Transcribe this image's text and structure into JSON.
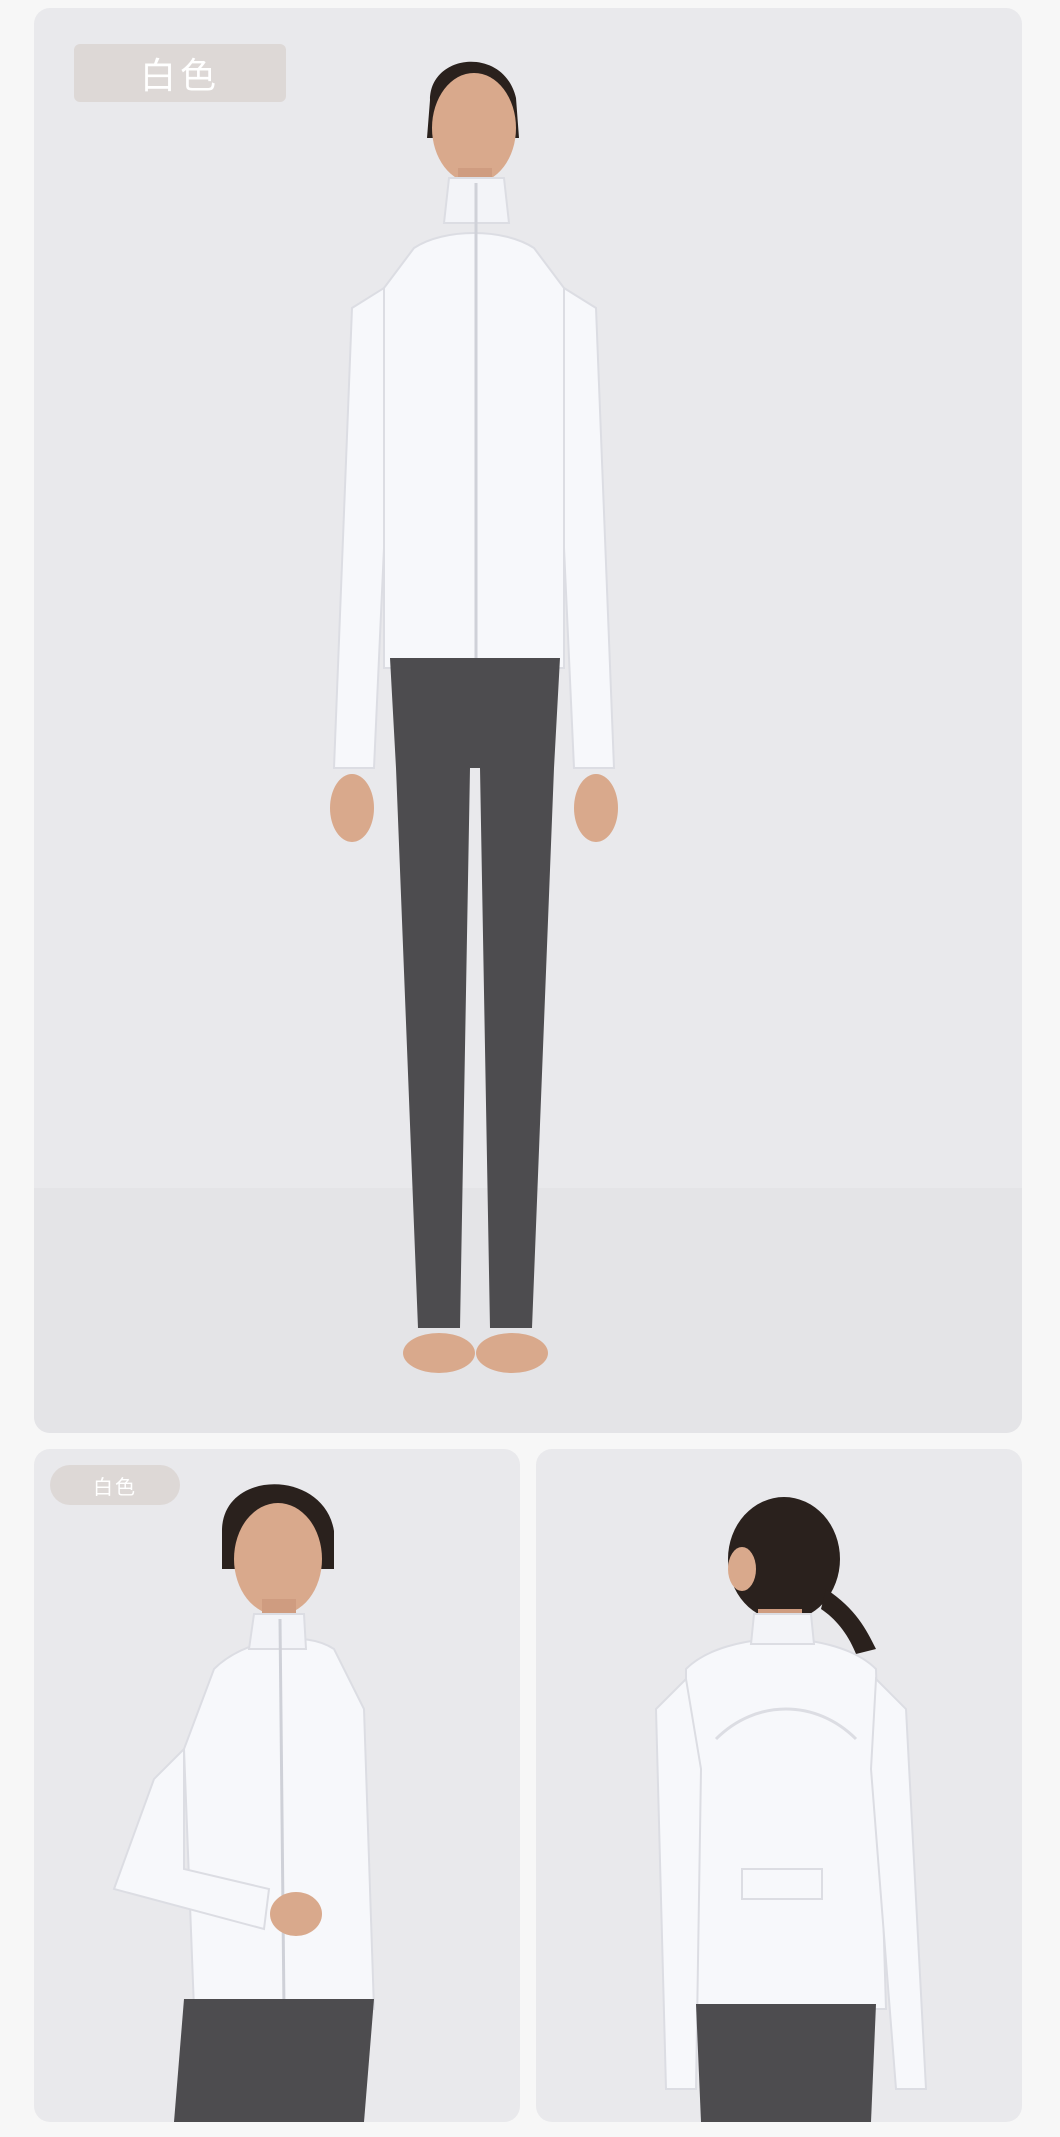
{
  "main_photo": {
    "color_tag": "白色",
    "subject": "model-front-full-body"
  },
  "side_photo": {
    "color_tag": "白色",
    "subject": "model-side-half-body"
  },
  "back_photo": {
    "subject": "model-back-half-body"
  },
  "colors": {
    "background": "#f7f7f7",
    "panel": "#e9e9ec",
    "tag_bg": "#ddd8d6",
    "jacket": "#f7f8fb",
    "leggings": "#4d4c4f",
    "hair": "#2a211d",
    "skin": "#d9a98c"
  }
}
